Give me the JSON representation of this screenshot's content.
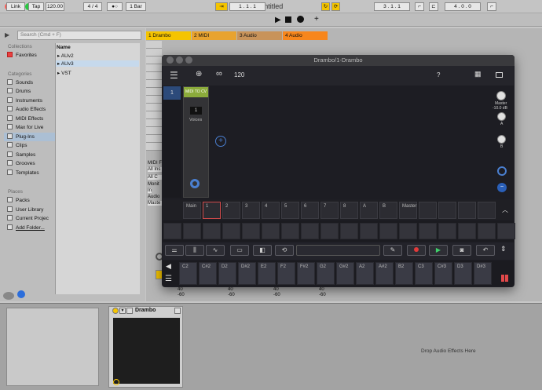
{
  "window": {
    "title": "Untitled"
  },
  "transport": {
    "link": "Link",
    "tap": "Tap",
    "tempo": "120.00",
    "signature": "4 / 4",
    "quantize": "1 Bar",
    "position": "1 .   1 .   1",
    "loop_start": "3 .   1 .   1",
    "loop_length": "4 .   0 .   0"
  },
  "browser": {
    "search_placeholder": "Search (Cmd + F)",
    "collections_header": "Collections",
    "favorites": "Favorites",
    "categories_header": "Categories",
    "categories": [
      "Sounds",
      "Drums",
      "Instruments",
      "Audio Effects",
      "MIDI Effects",
      "Max for Live",
      "Plug-Ins",
      "Clips",
      "Samples",
      "Grooves",
      "Templates"
    ],
    "places_header": "Places",
    "places": [
      "Packs",
      "User Library",
      "Current Projec",
      "Add Folder..."
    ],
    "name_header": "Name",
    "names": [
      "AUv2",
      "AUv3",
      "VST"
    ]
  },
  "tracks": [
    "1 Drambo",
    "2 MIDI",
    "3 Audio",
    "4 Audio"
  ],
  "mixer": {
    "value": "-60",
    "value2": "40"
  },
  "track_side": {
    "midi_from": "MIDI F",
    "all_ins": "All Ins",
    "all": "All C",
    "monitor": "Monit",
    "in": "In",
    "audio": "Audio",
    "master": "Maste"
  },
  "plugin": {
    "title": "Drambo/1-Drambo",
    "tempo": "120",
    "help": "?",
    "track_number": "1",
    "module_name": "MIDI TO CV",
    "voices_value": "1",
    "voices_label": "Voices",
    "master_label": "Master",
    "master_db": "-10.0 dB",
    "knob_a": "A",
    "knob_b": "B",
    "tabs": [
      "Main",
      "1",
      "2",
      "3",
      "4",
      "5",
      "6",
      "7",
      "8",
      "A",
      "B",
      "Master"
    ],
    "keys": [
      "C2",
      "C#2",
      "D2",
      "D#2",
      "E2",
      "F2",
      "F#2",
      "G2",
      "G#2",
      "A2",
      "A#2",
      "B2",
      "C3",
      "C#3",
      "D3",
      "D#3"
    ]
  },
  "device": {
    "name": "Drambo",
    "drop_text": "Drop Audio Effects Here"
  },
  "colors": {
    "track1": "#f5c400",
    "track2": "#e8a32f",
    "track3": "#c8935a",
    "track4": "#f7861c",
    "module": "#8bab3b",
    "play_green": "#3fd16b",
    "record_red": "#e23a3a",
    "plug_accent": "#4a7fd0"
  }
}
